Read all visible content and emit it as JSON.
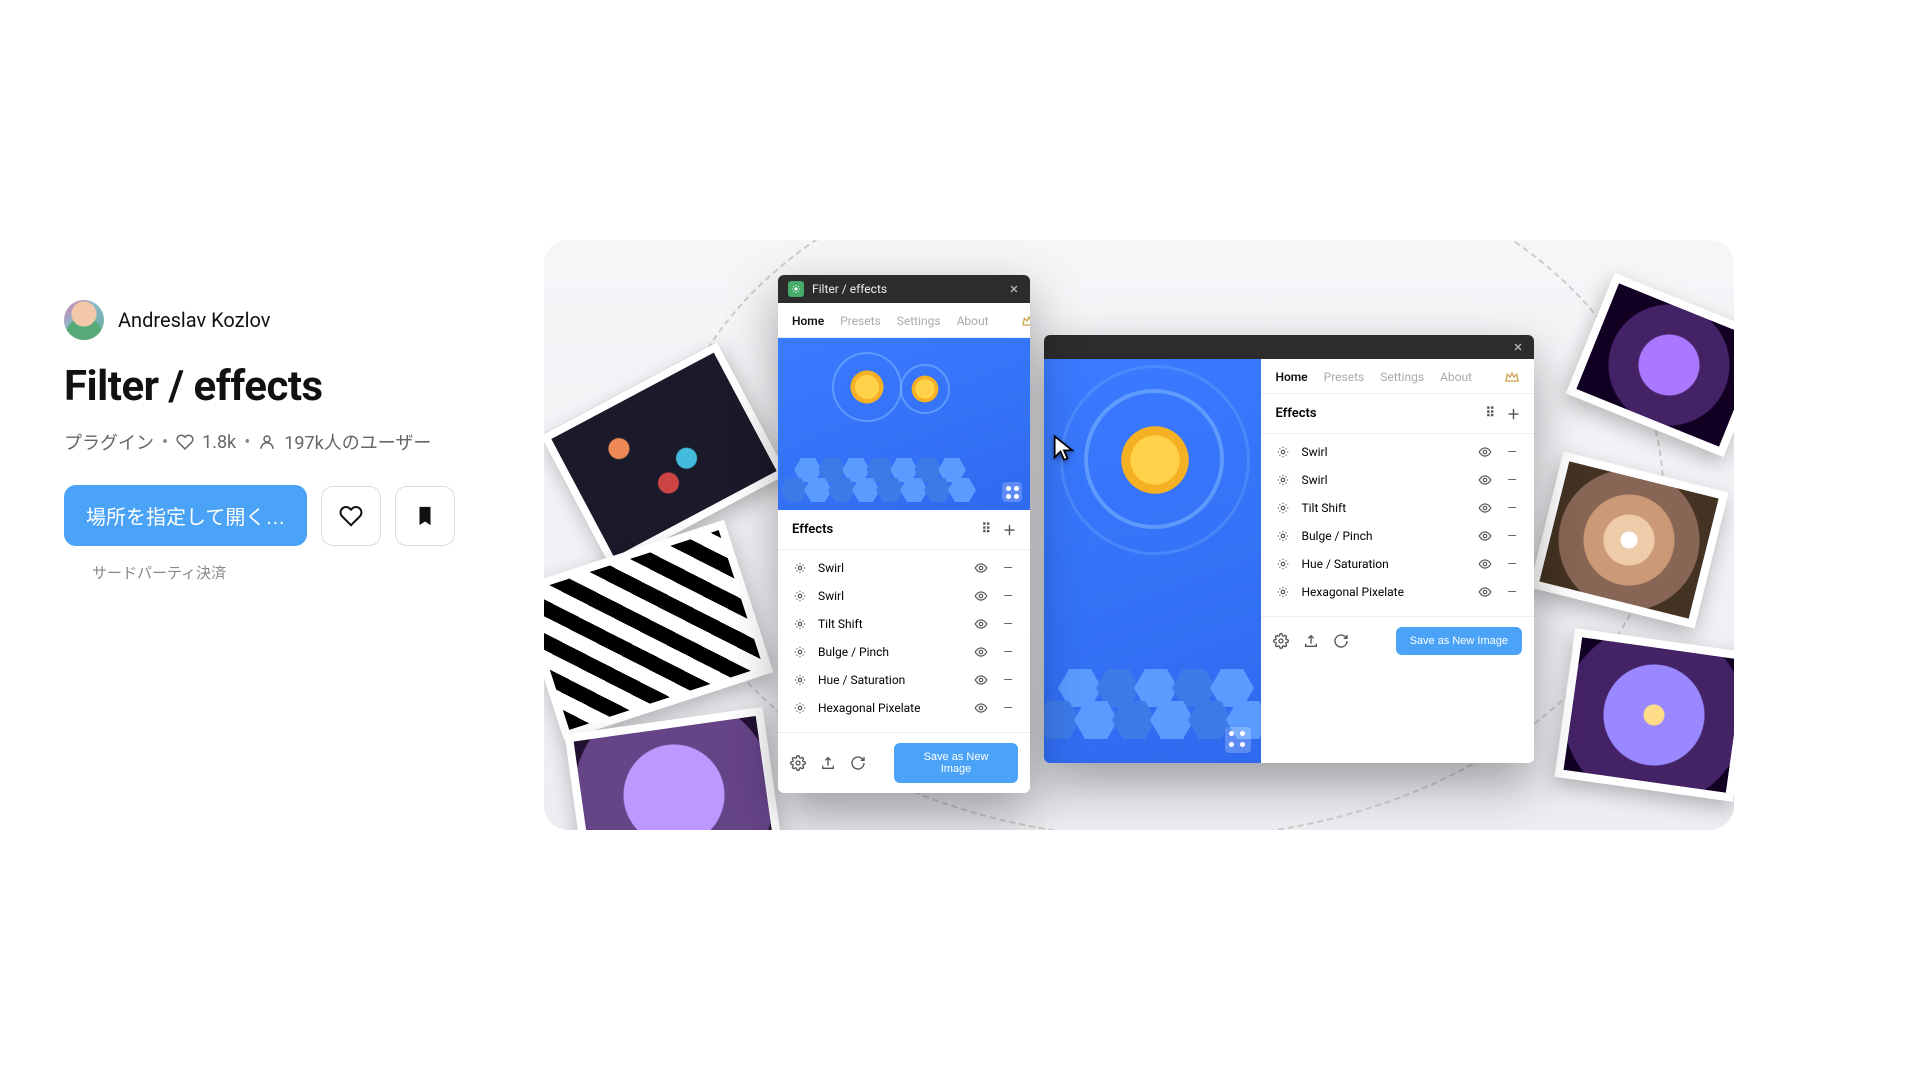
{
  "author": {
    "name": "Andreslav Kozlov"
  },
  "title": "Filter / effects",
  "meta": {
    "type": "プラグイン",
    "likes": "1.8k",
    "users": "197k人のユーザー"
  },
  "actions": {
    "open_label": "場所を指定して開く…",
    "payment_note": "サードパーティ決済"
  },
  "plugin_window": {
    "title": "Filter / effects",
    "tabs": [
      "Home",
      "Presets",
      "Settings",
      "About"
    ],
    "effects_header": "Effects",
    "save_label": "Save as New Image",
    "effects": [
      {
        "name": "Swirl"
      },
      {
        "name": "Swirl"
      },
      {
        "name": "Tilt Shift"
      },
      {
        "name": "Bulge / Pinch"
      },
      {
        "name": "Hue / Saturation"
      },
      {
        "name": "Hexagonal Pixelate"
      }
    ]
  }
}
